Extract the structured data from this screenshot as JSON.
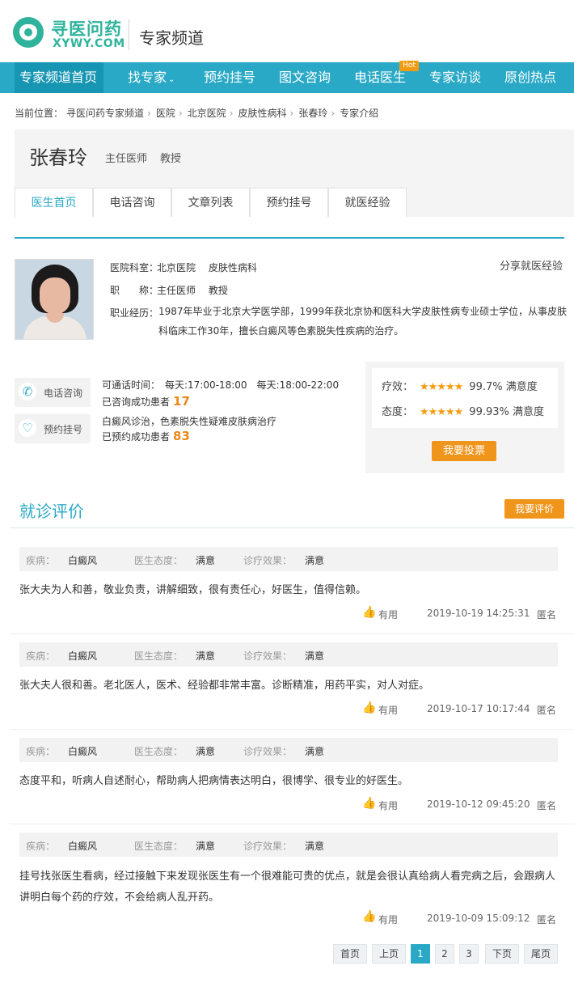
{
  "header": {
    "logo_cn": "寻医问药",
    "logo_en": "XYWY.COM",
    "channel_title": "专家频道"
  },
  "nav": {
    "items": [
      {
        "label": "专家频道首页"
      },
      {
        "label": "找专家"
      },
      {
        "label": "预约挂号"
      },
      {
        "label": "图文咨询"
      },
      {
        "label": "电话医生"
      },
      {
        "label": "专家访谈"
      },
      {
        "label": "原创热点"
      }
    ],
    "hot_badge": "Hot"
  },
  "breadcrumb": {
    "prefix": "当前位置：",
    "items": [
      "寻医问药专家频道",
      "医院",
      "北京医院",
      "皮肤性病科",
      "张春玲",
      "专家介绍"
    ]
  },
  "doctor": {
    "name": "张春玲",
    "title": "主任医师",
    "academic": "教授",
    "tabs": [
      "医生首页",
      "电话咨询",
      "文章列表",
      "预约挂号",
      "就医经验"
    ],
    "dept_label": "医院科室：",
    "dept_value": "北京医院　 皮肤性病科",
    "title_label": "职　　称：",
    "title_value": "主任医师　 教授",
    "career_label": "职业经历：",
    "career_value": "1987年毕业于北京大学医学部，1999年获北京协和医科大学皮肤性病专业硕士学位，从事皮肤科临床工作30年，擅长白癜风等色素脱失性疾病的治疗。",
    "share": "分享就医经验"
  },
  "service": {
    "phone_btn": "电话咨询",
    "booking_btn": "预约挂号",
    "call_time": "可通话时间：　每天:17:00-18:00　每天:18:00-22:00",
    "consulted_label": "已咨询成功患者",
    "consulted_count": "17",
    "specialty": "白癜风诊治，色素脱失性疑难皮肤病治疗",
    "booked_label": "已预约成功患者",
    "booked_count": "83"
  },
  "rating": {
    "effect_label": "疗效：",
    "effect_value": "99.7% 满意度",
    "attitude_label": "态度：",
    "attitude_value": "99.93% 满意度",
    "stars": "★★★★★",
    "vote_btn": "我要投票",
    "colors": {
      "star": "#f39c12",
      "button": "#f0951c"
    }
  },
  "reviews": {
    "title": "就诊评价",
    "write_btn": "我要评价",
    "disease_label": "疾病：",
    "attitude_label": "医生态度：",
    "effect_label": "诊疗效果：",
    "useful_label": "有用",
    "items": [
      {
        "disease": "白癜风",
        "attitude": "满意",
        "effect": "满意",
        "text": "张大夫为人和善，敬业负责，讲解细致，很有责任心，好医生，值得信赖。",
        "time": "2019-10-19 14:25:31",
        "author": "匿名"
      },
      {
        "disease": "白癜风",
        "attitude": "满意",
        "effect": "满意",
        "text": "张大夫人很和善。老北医人，医术、经验都非常丰富。诊断精准，用药平实，对人对症。",
        "time": "2019-10-17 10:17:44",
        "author": "匿名"
      },
      {
        "disease": "白癜风",
        "attitude": "满意",
        "effect": "满意",
        "text": "态度平和，听病人自述耐心，帮助病人把病情表达明白，很博学、很专业的好医生。",
        "time": "2019-10-12 09:45:20",
        "author": "匿名"
      },
      {
        "disease": "白癜风",
        "attitude": "满意",
        "effect": "满意",
        "text": "挂号找张医生看病，经过接触下来发现张医生有一个很难能可贵的优点，就是会很认真给病人看完病之后，会跟病人讲明白每个药的疗效，不会给病人乱开药。",
        "time": "2019-10-09 15:09:12",
        "author": "匿名"
      }
    ]
  },
  "pagination": {
    "first": "首页",
    "prev": "上页",
    "pages": [
      "1",
      "2",
      "3"
    ],
    "current": "1",
    "next": "下页",
    "last": "尾页"
  },
  "theme": {
    "accent": "#2aa9c6",
    "brand": "#2fb39d"
  }
}
